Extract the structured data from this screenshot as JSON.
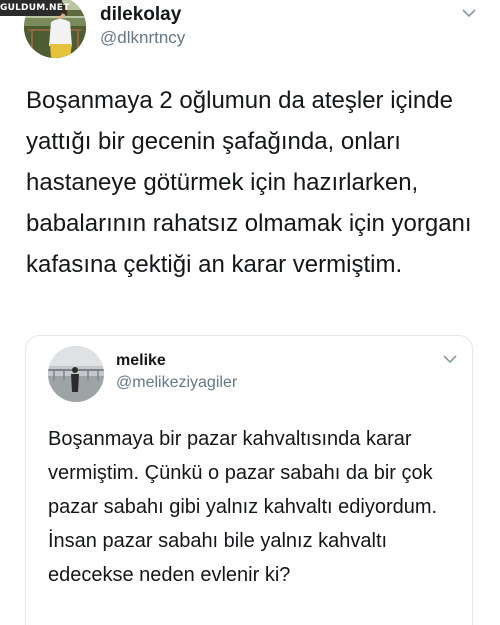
{
  "watermark": {
    "text": "GULDUM.NET"
  },
  "tweet": {
    "display_name": "dilekolay",
    "handle": "@dlknrtncy",
    "avatar": "profile-photo",
    "menu_icon": "chevron-down-icon",
    "text": "Boşanmaya 2 oğlumun da ateşler içinde yattığı bir gecenin şafağında, onları hastaneye götürmek için hazırlarken, babalarının rahatsız olmamak için yorganı kafasına çektiği an karar vermiştim."
  },
  "quoted_tweet": {
    "display_name": "melike",
    "handle": "@melikeziyagiler",
    "avatar": "profile-photo",
    "menu_icon": "chevron-down-icon",
    "text": "Boşanmaya bir pazar kahvaltısında karar vermiştim. Çünkü o pazar sabahı da bir çok pazar sabahı gibi yalnız kahvaltı ediyordum. İnsan pazar sabahı bile yalnız kahvaltı edecekse neden evlenir ki?"
  }
}
